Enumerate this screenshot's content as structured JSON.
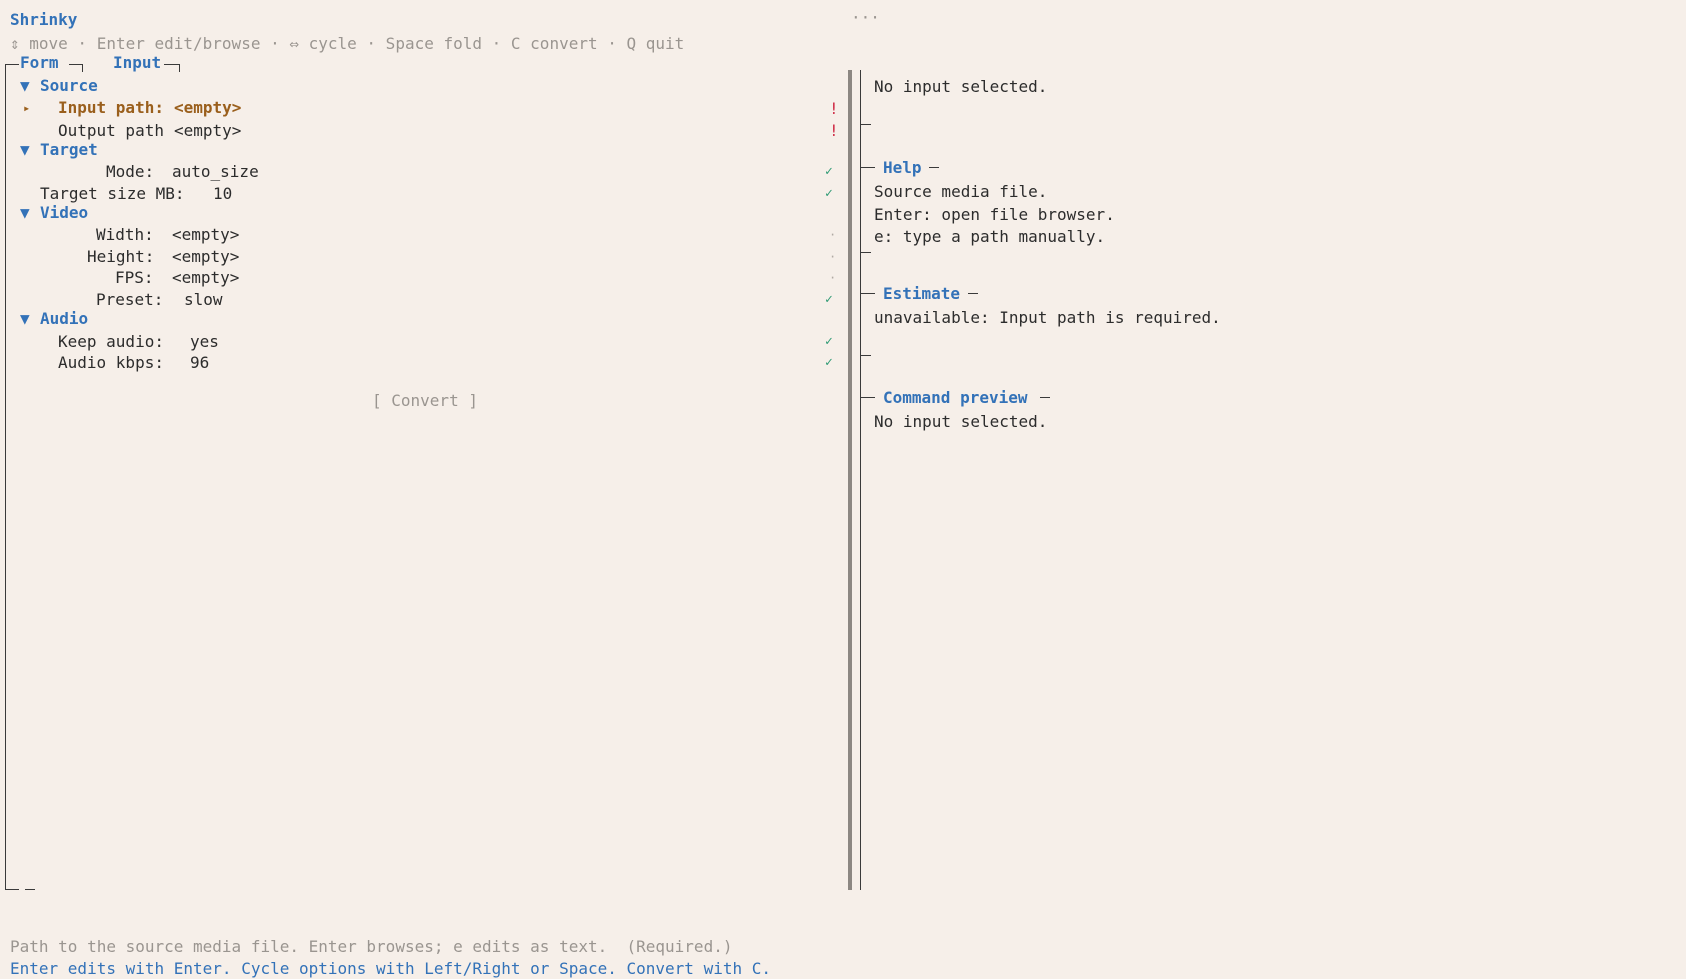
{
  "app": {
    "title": "Shrinky",
    "ellipsis": "···",
    "keyhints": "⇕ move · Enter edit/browse · ⇔ cycle · Space fold · C convert · Q quit"
  },
  "tabs": [
    {
      "label": "Form"
    },
    {
      "label": "Input"
    }
  ],
  "form": {
    "source": {
      "toggle": "▼",
      "title": "Source",
      "input_path": {
        "marker": "▸",
        "label": "Input path:",
        "value": "<empty>",
        "status": "!"
      },
      "output_path": {
        "label": "Output path",
        "value": "<empty>",
        "status": "!"
      }
    },
    "target": {
      "toggle": "▼",
      "title": "Target",
      "mode": {
        "label": "Mode:",
        "value": "auto_size",
        "status": "✓"
      },
      "size": {
        "label": "Target size MB:",
        "value": "10",
        "status": "✓"
      }
    },
    "video": {
      "toggle": "▼",
      "title": "Video",
      "width": {
        "label": "Width:",
        "value": "<empty>",
        "status": "·"
      },
      "height": {
        "label": "Height:",
        "value": "<empty>",
        "status": "·"
      },
      "fps": {
        "label": "FPS:",
        "value": "<empty>",
        "status": "·"
      },
      "preset": {
        "label": "Preset:",
        "value": "slow",
        "status": "✓"
      }
    },
    "audio": {
      "toggle": "▼",
      "title": "Audio",
      "keep": {
        "label": "Keep audio:",
        "value": "yes",
        "status": "✓"
      },
      "kbps": {
        "label": "Audio kbps:",
        "value": "96",
        "status": "✓"
      }
    },
    "convert_button": "[ Convert ]"
  },
  "right": {
    "input_info": "No input selected.",
    "help": {
      "title": "Help",
      "lines": [
        "Source media file.",
        "Enter: open file browser.",
        "e: type a path manually."
      ]
    },
    "estimate": {
      "title": "Estimate",
      "text": "unavailable: Input path is required."
    },
    "command": {
      "title": "Command preview",
      "text": "No input selected."
    }
  },
  "footer": {
    "description": "Path to the source media file. Enter browses; e edits as text.  (Required.)",
    "hint": "Enter edits with Enter. Cycle options with Left/Right or Space. Convert with C."
  },
  "colors": {
    "background": "#f6efe9",
    "accent": "#3372b8",
    "selected": "#9a5f1c",
    "error": "#d0304a",
    "ok": "#2f9a74"
  }
}
